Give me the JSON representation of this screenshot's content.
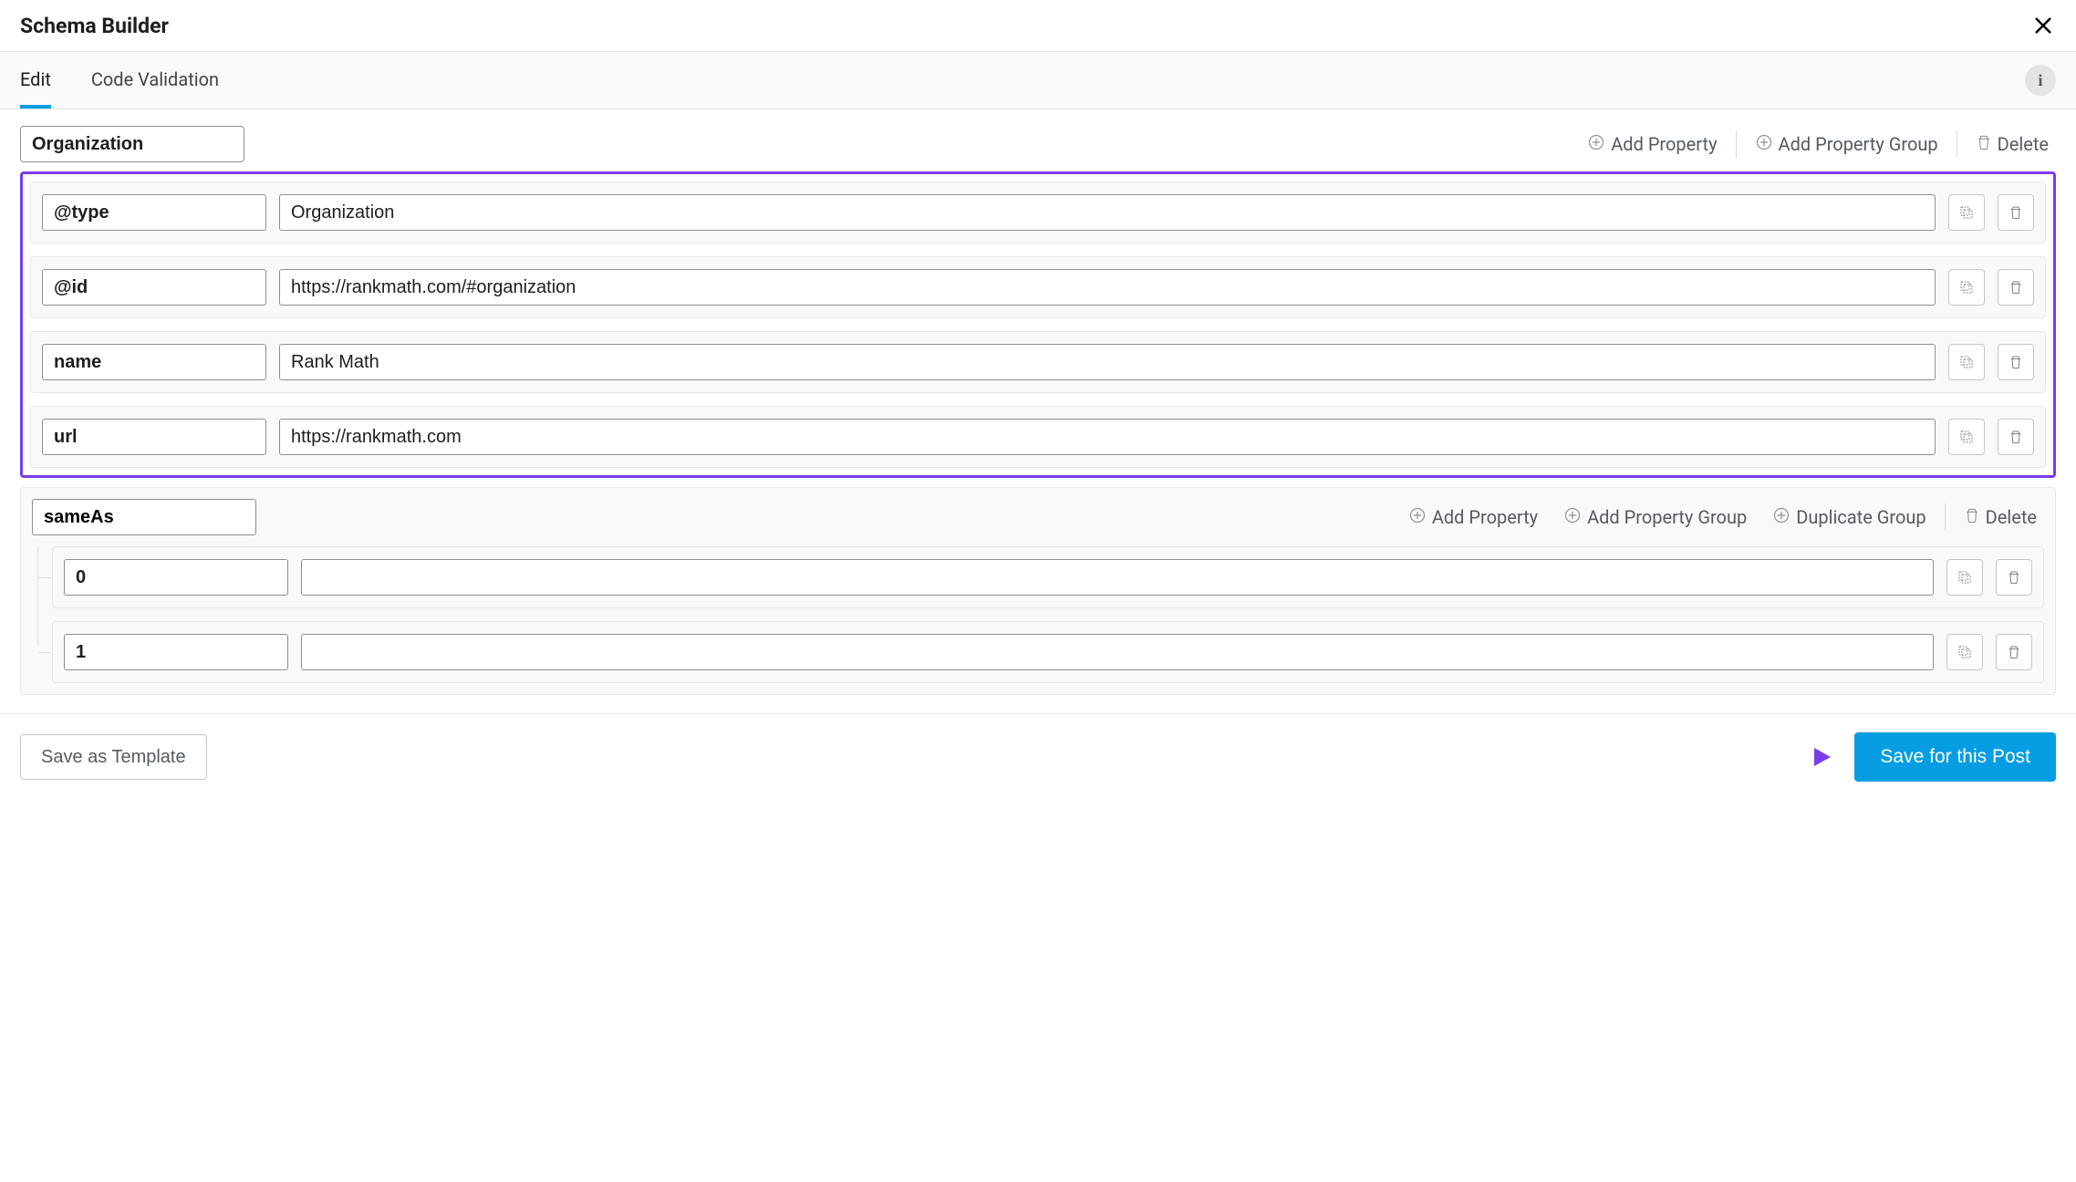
{
  "header": {
    "title": "Schema Builder"
  },
  "tabs": {
    "edit": "Edit",
    "validation": "Code Validation"
  },
  "schemaHead": {
    "name": "Organization",
    "addProperty": "Add Property",
    "addGroup": "Add Property Group",
    "delete": "Delete"
  },
  "properties": [
    {
      "key": "@type",
      "value": "Organization"
    },
    {
      "key": "@id",
      "value": "https://rankmath.com/#organization"
    },
    {
      "key": "name",
      "value": "Rank Math"
    },
    {
      "key": "url",
      "value": "https://rankmath.com"
    }
  ],
  "group": {
    "name": "sameAs",
    "addProperty": "Add Property",
    "addGroup": "Add Property Group",
    "duplicate": "Duplicate Group",
    "delete": "Delete",
    "children": [
      {
        "key": "0",
        "value": ""
      },
      {
        "key": "1",
        "value": ""
      }
    ]
  },
  "footer": {
    "saveTemplate": "Save as Template",
    "savePost": "Save for this Post"
  }
}
